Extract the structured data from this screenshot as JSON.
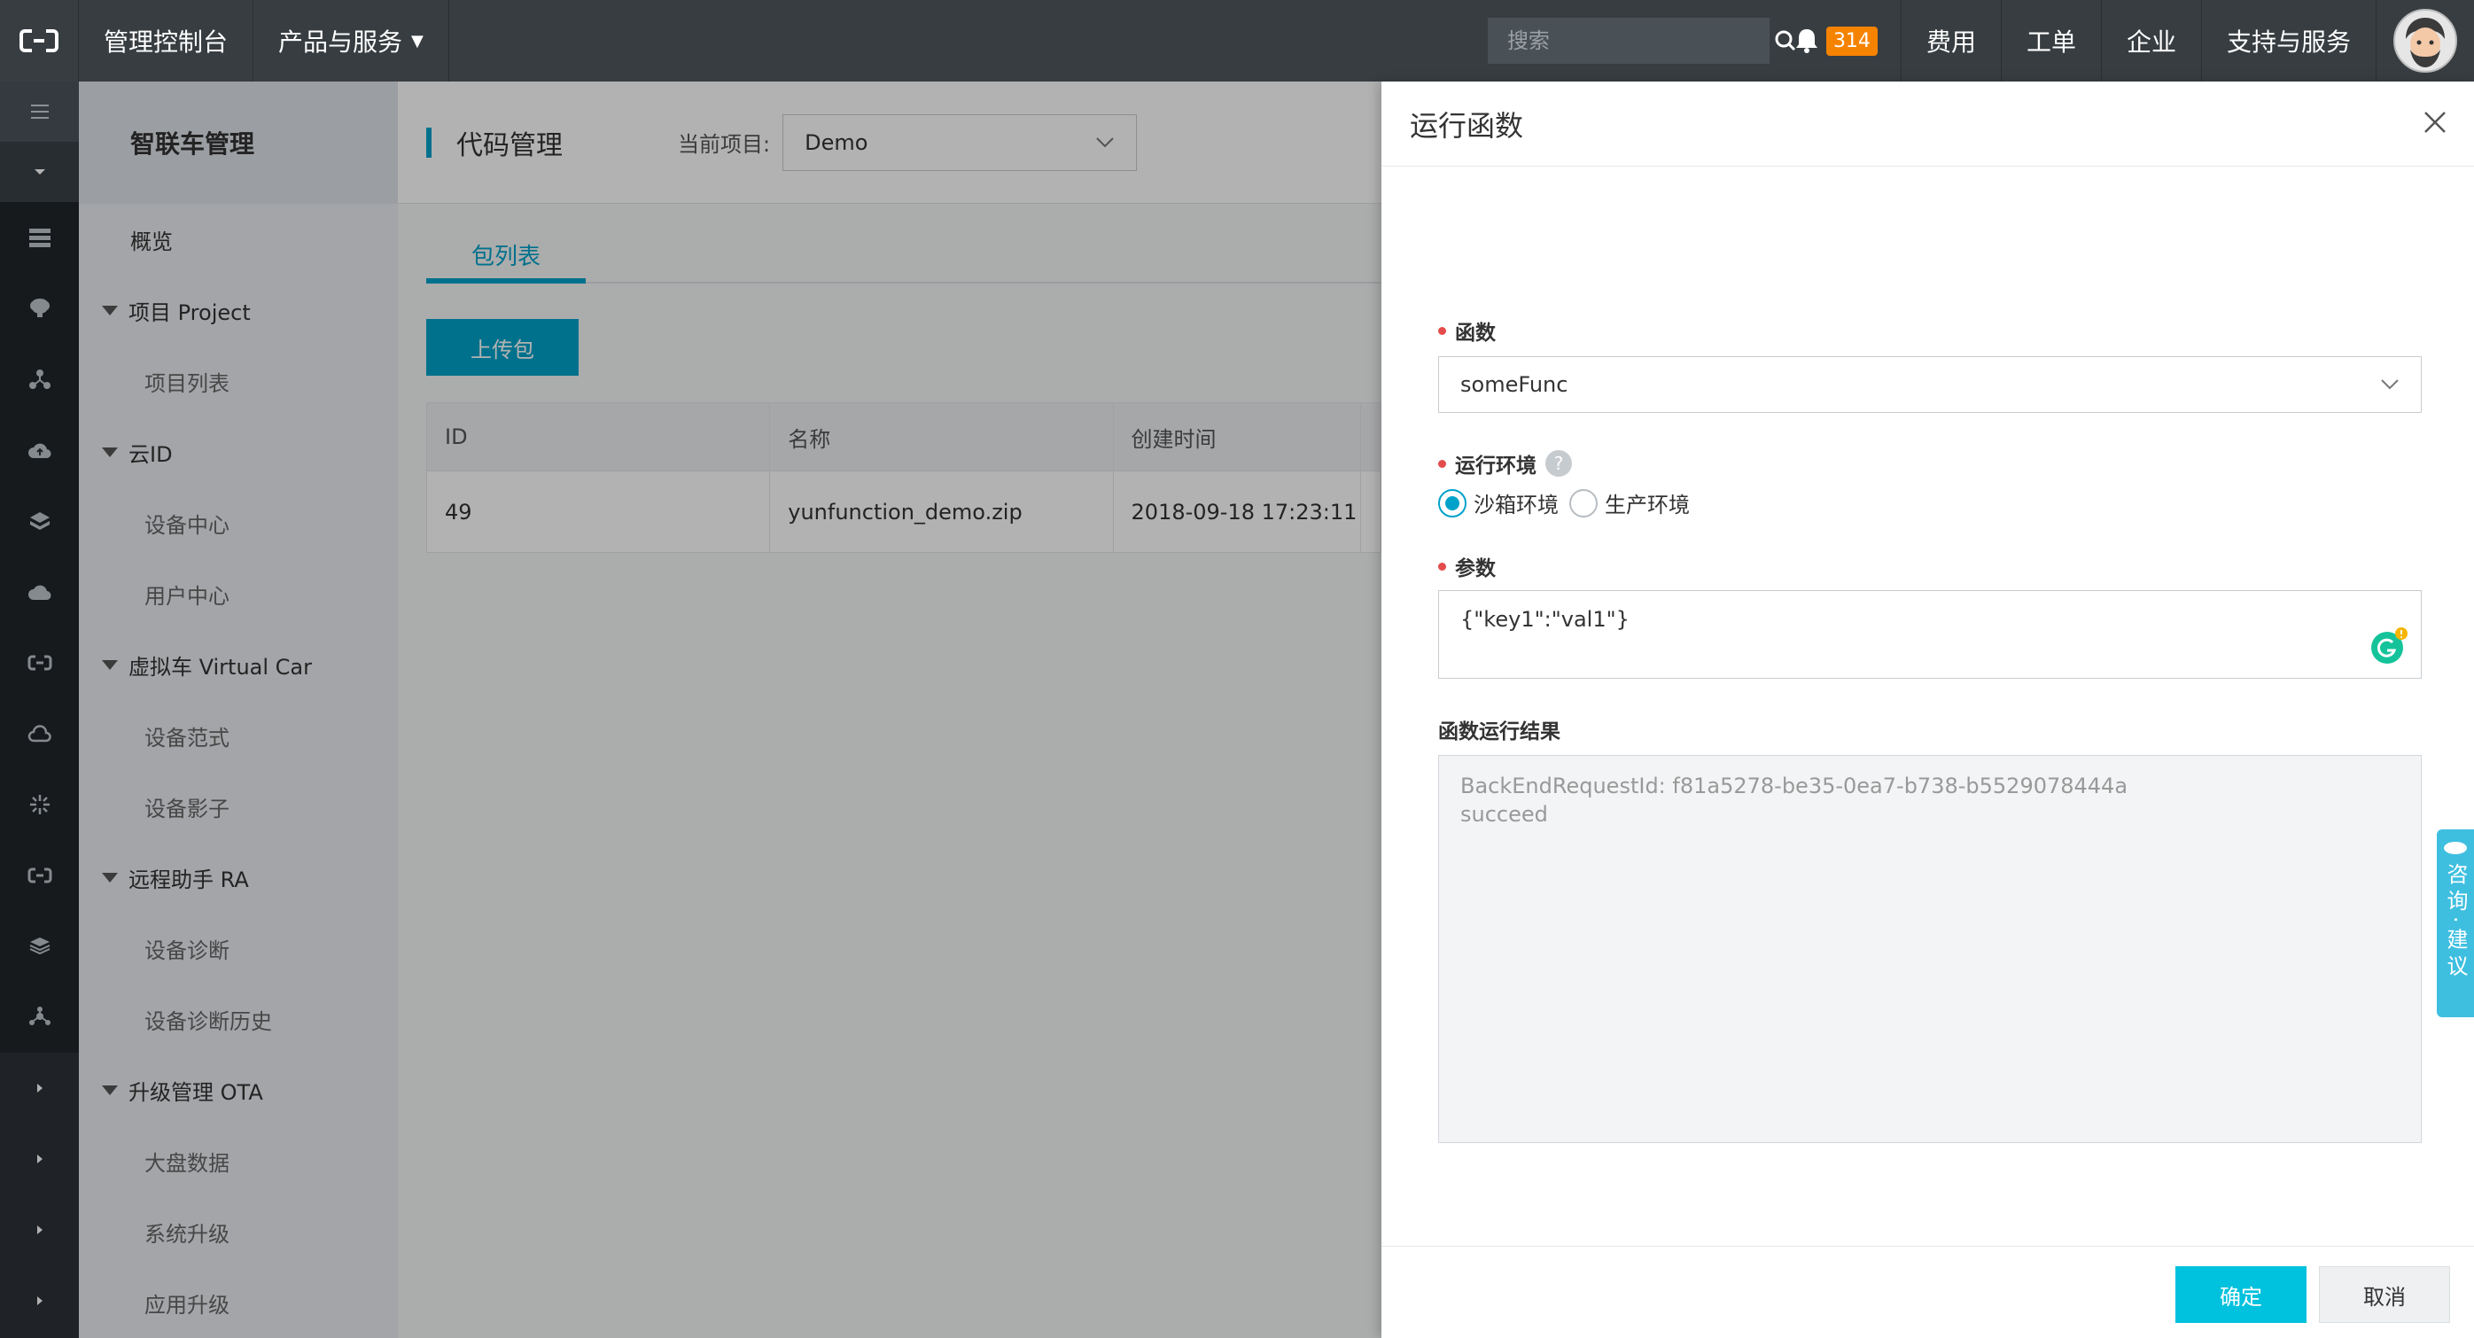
{
  "topbar": {
    "console_label": "管理控制台",
    "products_label": "产品与服务",
    "search_placeholder": "搜索",
    "notification_count": "314",
    "links": [
      "费用",
      "工单",
      "企业",
      "支持与服务"
    ]
  },
  "product_nav": {
    "title": "智联车管理",
    "items": [
      {
        "type": "item",
        "label": "概览"
      },
      {
        "type": "group",
        "label": "项目 Project"
      },
      {
        "type": "sub",
        "label": "项目列表"
      },
      {
        "type": "group",
        "label": "云ID"
      },
      {
        "type": "sub",
        "label": "设备中心"
      },
      {
        "type": "sub",
        "label": "用户中心"
      },
      {
        "type": "group",
        "label": "虚拟车 Virtual Car"
      },
      {
        "type": "sub",
        "label": "设备范式"
      },
      {
        "type": "sub",
        "label": "设备影子"
      },
      {
        "type": "group",
        "label": "远程助手 RA"
      },
      {
        "type": "sub",
        "label": "设备诊断"
      },
      {
        "type": "sub",
        "label": "设备诊断历史"
      },
      {
        "type": "group",
        "label": "升级管理 OTA"
      },
      {
        "type": "sub",
        "label": "大盘数据"
      },
      {
        "type": "sub",
        "label": "系统升级"
      },
      {
        "type": "sub",
        "label": "应用升级"
      }
    ]
  },
  "main": {
    "title": "代码管理",
    "project_label": "当前项目:",
    "project_value": "Demo",
    "tab_label": "包列表",
    "upload_label": "上传包",
    "table": {
      "headers": [
        "ID",
        "名称",
        "创建时间",
        ""
      ],
      "rows": [
        [
          "49",
          "yunfunction_demo.zip",
          "2018-09-18 17:23:11",
          ""
        ]
      ]
    }
  },
  "dialog": {
    "title": "运行函数",
    "function_label": "函数",
    "function_value": "someFunc",
    "env_label": "运行环境",
    "help_glyph": "?",
    "env_options": [
      "沙箱环境",
      "生产环境"
    ],
    "env_selected": "沙箱环境",
    "params_label": "参数",
    "params_value": "{\"key1\":\"val1\"}",
    "result_label": "函数运行结果",
    "result_line1": "BackEndRequestId: f81a5278-be35-0ea7-b738-b5529078444a",
    "result_line2": "succeed",
    "ok_label": "确定",
    "cancel_label": "取消"
  },
  "consult": {
    "label": "咨询·建议"
  },
  "colors": {
    "accent": "#00a2ca",
    "ok_button": "#00c1de",
    "topbar": "#373d41",
    "badge": "#f68300"
  }
}
